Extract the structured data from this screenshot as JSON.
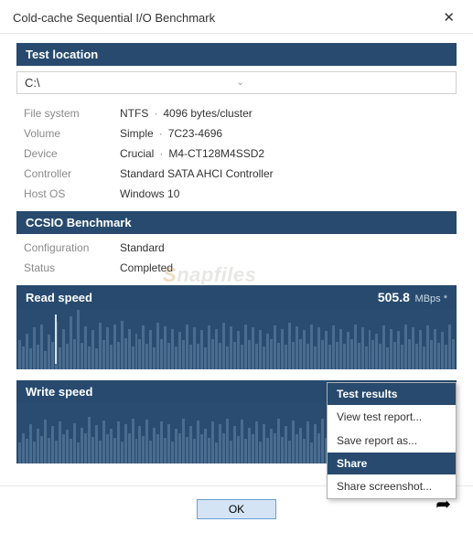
{
  "window": {
    "title": "Cold-cache Sequential I/O Benchmark"
  },
  "sections": {
    "test_location": "Test location",
    "ccsio": "CCSIO Benchmark",
    "read": "Read speed",
    "write": "Write speed"
  },
  "drive": {
    "selected": "C:\\"
  },
  "info": {
    "fs_label": "File system",
    "fs_val": "NTFS",
    "fs_extra": "4096 bytes/cluster",
    "vol_label": "Volume",
    "vol_val": "Simple",
    "vol_extra": "7C23-4696",
    "dev_label": "Device",
    "dev_val": "Crucial",
    "dev_extra": "M4-CT128M4SSD2",
    "ctrl_label": "Controller",
    "ctrl_val": "Standard SATA AHCI Controller",
    "os_label": "Host OS",
    "os_val": "Windows 10",
    "cfg_label": "Configuration",
    "cfg_val": "Standard",
    "status_label": "Status",
    "status_val": "Completed"
  },
  "read_speed": {
    "value": "505.8",
    "unit": "MBps *"
  },
  "buttons": {
    "ok": "OK"
  },
  "menu": {
    "results_hdr": "Test results",
    "view_report": "View test report...",
    "save_report": "Save report as...",
    "share_hdr": "Share",
    "share_shot": "Share screenshot..."
  },
  "watermark": {
    "prefix": "S",
    "rest": "napfiles"
  },
  "chart_data": [
    {
      "type": "bar",
      "title": "Read speed",
      "ylabel": "MBps",
      "ylim": [
        0,
        520
      ],
      "values": [
        250,
        200,
        310,
        180,
        360,
        210,
        390,
        160,
        300,
        240,
        410,
        190,
        350,
        220,
        460,
        260,
        510,
        230,
        370,
        200,
        340,
        180,
        400,
        250,
        360,
        210,
        390,
        240,
        420,
        270,
        350,
        200,
        310,
        260,
        380,
        220,
        340,
        190,
        400,
        260,
        370,
        230,
        350,
        200,
        320,
        250,
        390,
        210,
        360,
        220,
        340,
        190,
        380,
        260,
        350,
        230,
        400,
        200,
        370,
        240,
        330,
        210,
        390,
        250,
        360,
        220,
        340,
        200,
        310,
        260,
        380,
        230,
        350,
        210,
        400,
        240,
        370,
        260,
        340,
        220,
        390,
        200,
        360,
        250,
        330,
        210,
        380,
        240,
        350,
        220,
        320,
        260,
        390,
        230,
        360,
        200,
        340,
        250,
        310,
        220,
        380,
        190,
        350,
        240,
        330,
        210,
        390,
        260,
        360,
        220,
        340,
        200,
        380,
        250,
        350,
        230,
        320,
        210,
        390,
        260
      ]
    },
    {
      "type": "bar",
      "title": "Write speed",
      "ylabel": "MBps",
      "ylim": [
        0,
        520
      ],
      "values": [
        180,
        260,
        210,
        340,
        190,
        300,
        240,
        380,
        220,
        320,
        200,
        360,
        250,
        290,
        210,
        350,
        180,
        310,
        260,
        400,
        230,
        330,
        200,
        370,
        250,
        300,
        220,
        360,
        190,
        340,
        260,
        390,
        210,
        320,
        240,
        380,
        200,
        310,
        250,
        360,
        220,
        340,
        190,
        300,
        260,
        390,
        230,
        320,
        210,
        370,
        250,
        300,
        220,
        360,
        180,
        340,
        260,
        390,
        200,
        320,
        240,
        380,
        210,
        310,
        250,
        360,
        190,
        340,
        220,
        300,
        260,
        390,
        230,
        320,
        200,
        370,
        250,
        310,
        210,
        360,
        180,
        340,
        260,
        390,
        220,
        320,
        240,
        380,
        200,
        300,
        250,
        360,
        210,
        340,
        190,
        310,
        260,
        390,
        230,
        320,
        200,
        370,
        250,
        300,
        220,
        360,
        180,
        340,
        260,
        390,
        210,
        320,
        240,
        380,
        200,
        310,
        250,
        360,
        220,
        340
      ]
    }
  ]
}
